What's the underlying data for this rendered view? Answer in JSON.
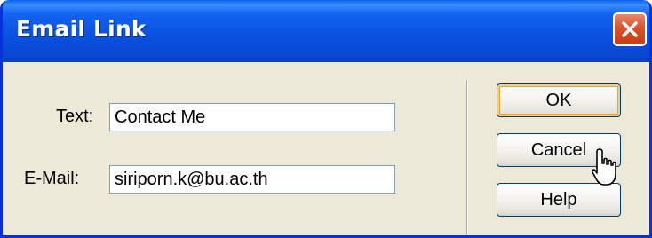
{
  "window": {
    "title": "Email Link"
  },
  "form": {
    "text_label": "Text:",
    "text_value": "Contact Me",
    "email_label": "E-Mail:",
    "email_value": "siriporn.k@bu.ac.th"
  },
  "buttons": {
    "ok_label": "OK",
    "cancel_label": "Cancel",
    "help_label": "Help"
  },
  "icons": {
    "close": "close-icon",
    "cursor": "pointer-cursor-icon"
  },
  "colors": {
    "titlebar": "#0a53e0",
    "close": "#d9532a",
    "dialog_bg": "#ece9d8",
    "focus_ring": "#f7cd7c"
  }
}
